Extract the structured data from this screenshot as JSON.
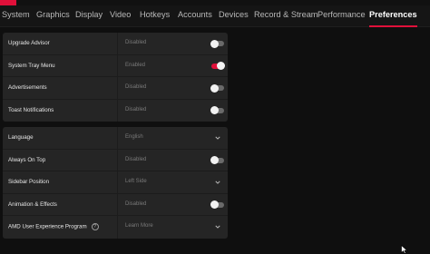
{
  "nav": {
    "tabs": [
      {
        "label": "System",
        "active": false
      },
      {
        "label": "Graphics",
        "active": false
      },
      {
        "label": "Display",
        "active": false
      },
      {
        "label": "Video",
        "active": false
      },
      {
        "label": "Hotkeys",
        "active": false
      },
      {
        "label": "Accounts",
        "active": false
      },
      {
        "label": "Devices",
        "active": false
      },
      {
        "label": "Record & Stream",
        "active": false
      },
      {
        "label": "Performance",
        "active": false
      },
      {
        "label": "Preferences",
        "active": true
      }
    ]
  },
  "group1": {
    "rows": [
      {
        "label": "Upgrade Advisor",
        "value": "Disabled",
        "control": "toggle",
        "on": false
      },
      {
        "label": "System Tray Menu",
        "value": "Enabled",
        "control": "toggle",
        "on": true
      },
      {
        "label": "Advertisements",
        "value": "Disabled",
        "control": "toggle",
        "on": false
      },
      {
        "label": "Toast Notifications",
        "value": "Disabled",
        "control": "toggle",
        "on": false
      }
    ]
  },
  "group2": {
    "rows": [
      {
        "label": "Language",
        "value": "English",
        "control": "dropdown"
      },
      {
        "label": "Always On Top",
        "value": "Disabled",
        "control": "toggle",
        "on": false
      },
      {
        "label": "Sidebar Position",
        "value": "Left Side",
        "control": "dropdown"
      },
      {
        "label": "Animation & Effects",
        "value": "Disabled",
        "control": "toggle",
        "on": false
      },
      {
        "label": "AMD User Experience Program",
        "value": "Learn More",
        "control": "dropdown",
        "help": "?"
      }
    ]
  },
  "colors": {
    "accent": "#e0103a",
    "background": "#0f0f0f",
    "panel": "#252525"
  }
}
